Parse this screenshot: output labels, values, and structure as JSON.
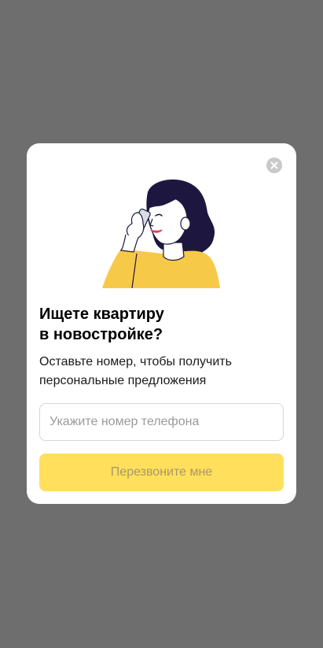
{
  "modal": {
    "title": "Ищете квартиру\nв новостройке?",
    "subtitle": "Оставьте номер, чтобы получить\nперсональные предложения",
    "phone_placeholder": "Укажите номер телефона",
    "phone_value": "",
    "callback_label": "Перезвоните мне",
    "close_icon": "close-icon",
    "illustration": "woman-on-phone-illustration"
  },
  "colors": {
    "overlay": "#6e6e6e",
    "button": "#ffdf5b",
    "illustration_yellow": "#f7c948",
    "hair": "#1d1740"
  }
}
